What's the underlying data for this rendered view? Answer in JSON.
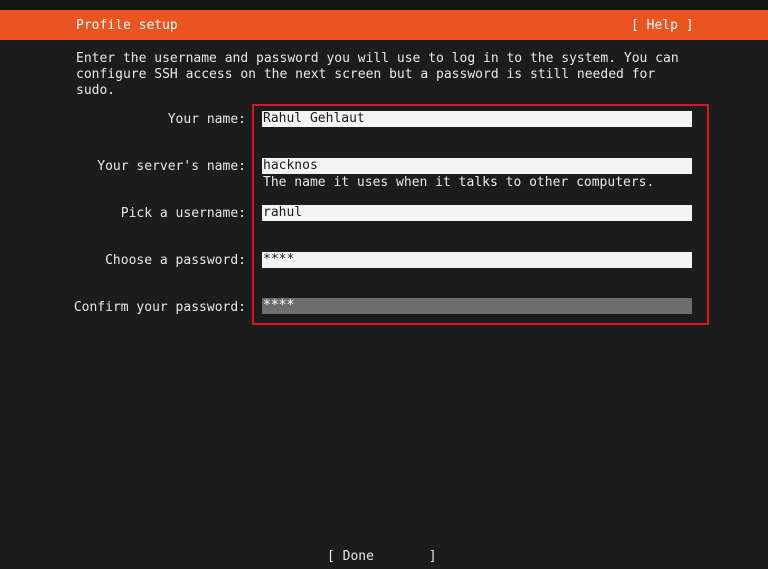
{
  "header": {
    "title": "Profile setup",
    "help_label": "[ Help ]"
  },
  "intro_text": "Enter the username and password you will use to log in to the system. You can\nconfigure SSH access on the next screen but a password is still needed for\nsudo.",
  "form": {
    "name": {
      "label": "Your name:",
      "value": "Rahul Gehlaut"
    },
    "server_name": {
      "label": "Your server's name:",
      "value": "hacknos",
      "hint": "The name it uses when it talks to other computers."
    },
    "username": {
      "label": "Pick a username:",
      "value": "rahul"
    },
    "password": {
      "label": "Choose a password:",
      "value": "****"
    },
    "confirm_password": {
      "label": "Confirm your password:",
      "value": "****"
    }
  },
  "footer": {
    "done_label": "[ Done       ]"
  },
  "colors": {
    "background": "#1c1c1c",
    "header": "#e95420",
    "highlight_border": "#e0141c",
    "field_bg": "#f4f4f4",
    "focused_field_bg": "#6e6e6e"
  }
}
